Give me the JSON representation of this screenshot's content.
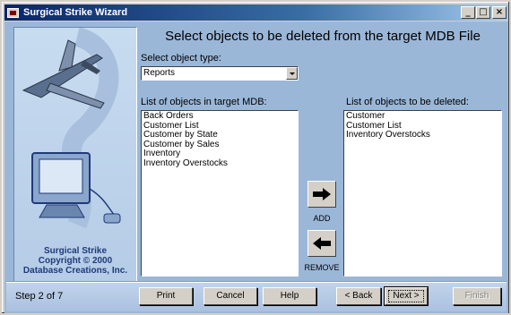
{
  "window": {
    "title": "Surgical Strike Wizard"
  },
  "title_buttons": {
    "minimize": "_",
    "maximize": "□",
    "close": "×"
  },
  "brand": {
    "line1": "Surgical Strike",
    "line2": "Copyright © 2000",
    "line3": "Database Creations, Inc."
  },
  "header": {
    "title": "Select objects to be deleted from the target MDB File"
  },
  "object_type": {
    "label": "Select object type:",
    "value": "Reports"
  },
  "source_list": {
    "label": "List of objects in target MDB:",
    "items": [
      "Back Orders",
      "Customer List",
      "Customer by State",
      "Customer by Sales",
      "Inventory",
      "Inventory Overstocks"
    ]
  },
  "target_list": {
    "label": "List of objects to be deleted:",
    "items": [
      "Customer",
      "Customer List",
      "Inventory Overstocks"
    ]
  },
  "move": {
    "add_label": "ADD",
    "remove_label": "REMOVE"
  },
  "footer": {
    "step": "Step 2 of 7",
    "print": "Print",
    "cancel": "Cancel",
    "help": "Help",
    "back": "< Back",
    "next": "Next >",
    "finish": "Finish"
  }
}
